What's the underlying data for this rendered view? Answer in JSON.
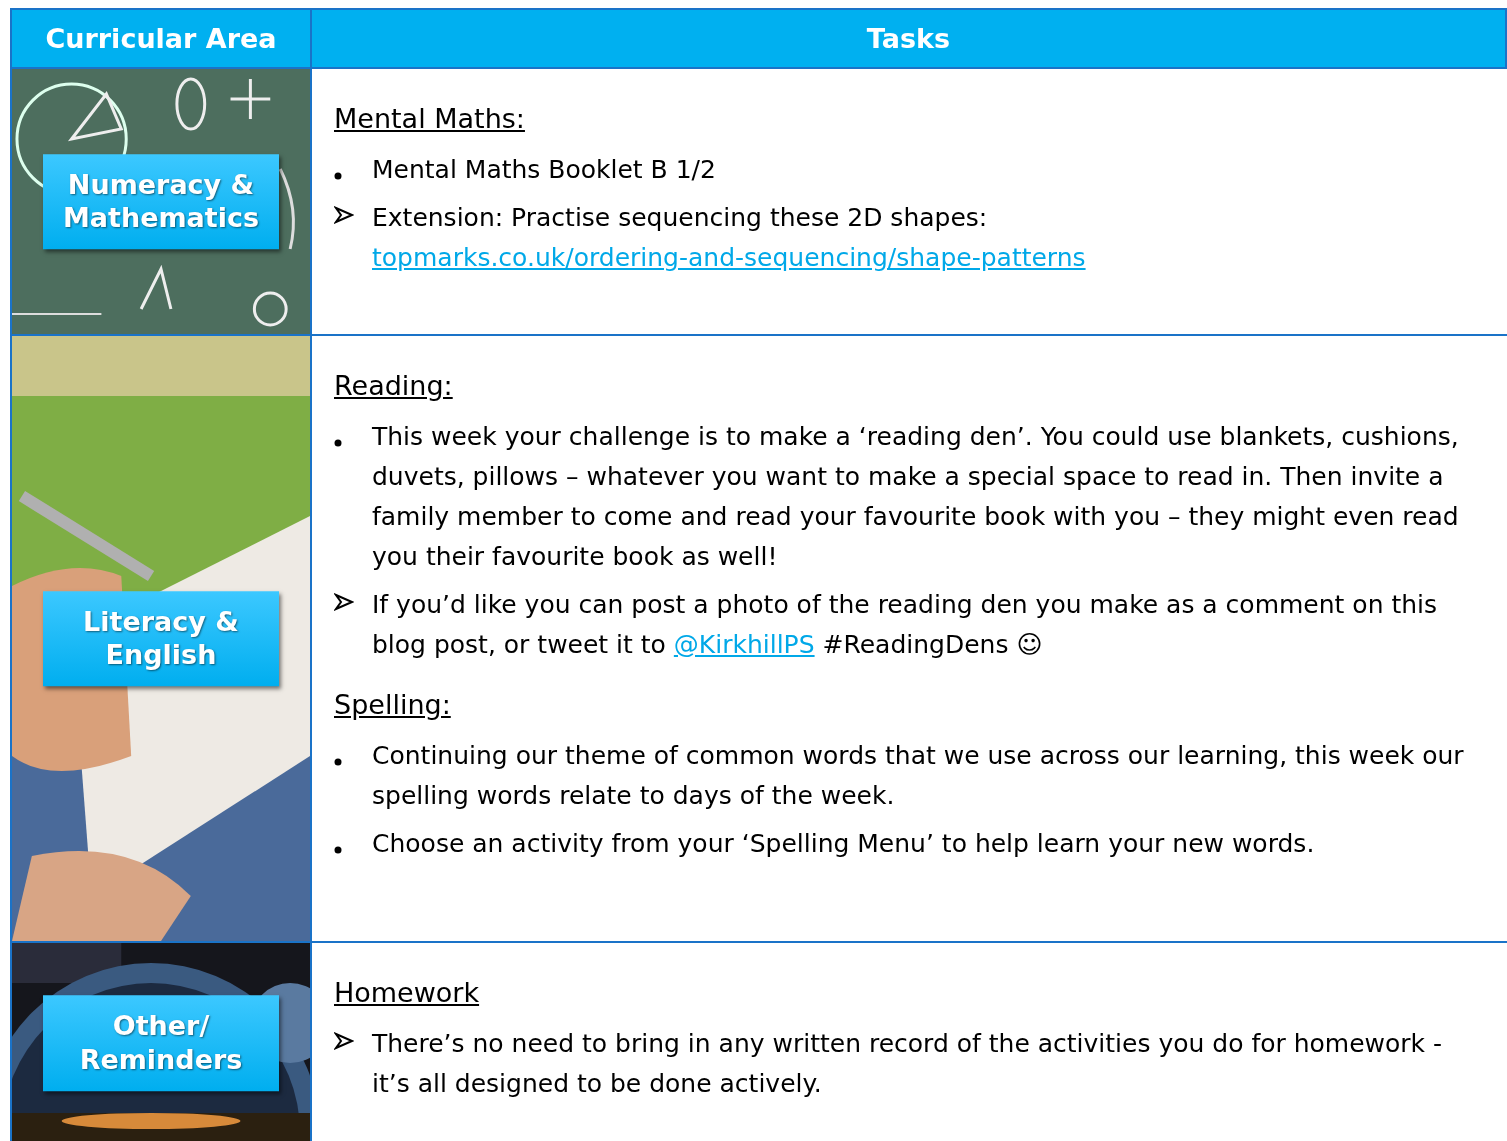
{
  "header": {
    "columns": [
      "Curricular Area",
      "Tasks"
    ]
  },
  "rows": [
    {
      "area": "Numeracy & Mathematics",
      "sections": [
        {
          "heading": "Mental Maths:",
          "items": [
            {
              "kind": "bullet",
              "parts": [
                {
                  "kind": "text",
                  "text": "Mental Maths Booklet B 1/2"
                }
              ]
            },
            {
              "kind": "arrow",
              "parts": [
                {
                  "kind": "text",
                  "text": "Extension: Practise sequencing these 2D shapes:"
                },
                {
                  "kind": "break"
                },
                {
                  "kind": "link",
                  "text": "topmarks.co.uk/ordering-and-sequencing/shape-patterns"
                }
              ]
            }
          ]
        }
      ]
    },
    {
      "area": "Literacy & English",
      "sections": [
        {
          "heading": "Reading:",
          "items": [
            {
              "kind": "bullet",
              "parts": [
                {
                  "kind": "text",
                  "text": "This week your challenge is to make a ‘reading den’. You could use blankets, cushions, duvets, pillows – whatever you want to make a special space to read in. Then invite a family member to come and read your favourite book with you – they might even read you their favourite book as well!"
                }
              ]
            },
            {
              "kind": "arrow",
              "parts": [
                {
                  "kind": "text",
                  "text": "If you’d like you can post a photo of the reading den you make as a comment on this blog post, or tweet it to "
                },
                {
                  "kind": "link",
                  "text": "@KirkhillPS"
                },
                {
                  "kind": "text",
                  "text": " #ReadingDens ☺"
                }
              ]
            }
          ]
        },
        {
          "heading": "Spelling:",
          "items": [
            {
              "kind": "bullet",
              "parts": [
                {
                  "kind": "text",
                  "text": "Continuing our theme of common words that we use across our learning, this week our spelling words relate to days of the week."
                }
              ]
            },
            {
              "kind": "bullet",
              "parts": [
                {
                  "kind": "text",
                  "text": "Choose an activity from your ‘Spelling Menu’ to help learn your new words."
                }
              ]
            }
          ]
        }
      ]
    },
    {
      "area": "Other/ Reminders",
      "sections": [
        {
          "heading": "Homework",
          "items": [
            {
              "kind": "arrow",
              "parts": [
                {
                  "kind": "text",
                  "text": "There’s no need to bring in any written record of the activities you do for homework - it’s all designed to be done actively."
                }
              ]
            }
          ]
        }
      ]
    }
  ]
}
